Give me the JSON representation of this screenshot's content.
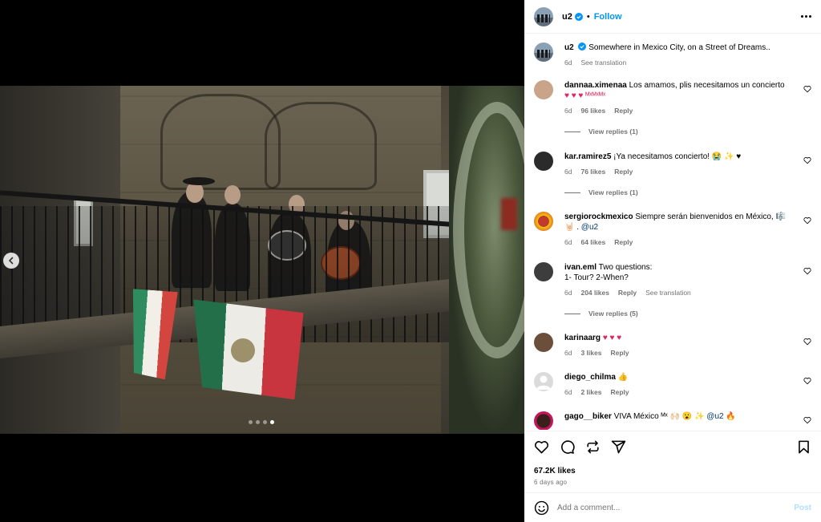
{
  "post": {
    "username": "u2",
    "follow_label": "Follow",
    "separator": "•",
    "caption": "Somewhere in Mexico City, on a Street of Dreams..",
    "caption_age": "6d",
    "see_translation": "See translation"
  },
  "carousel": {
    "slide_count": 4,
    "active_index": 3
  },
  "comments": [
    {
      "user": "dannaa.ximenaa",
      "text": "Los amamos, plis necesitamos un concierto",
      "text2": "♥ ♥ ♥ ᴹˣᴹˣᴹˣ",
      "age": "6d",
      "likes": "96 likes",
      "reply": "Reply",
      "view_replies": "View replies (1)"
    },
    {
      "user": "kar.ramirez5",
      "text": "¡Ya necesitamos concierto! 😭 ✨ ♥",
      "age": "6d",
      "likes": "76 likes",
      "reply": "Reply",
      "view_replies": "View replies (1)"
    },
    {
      "user": "sergiorockmexico",
      "text": "Siempre serán bienvenidos en México, 🎼",
      "text2": "🤘🏻 .",
      "mention": "@u2",
      "age": "6d",
      "likes": "64 likes",
      "reply": "Reply"
    },
    {
      "user": "ivan.eml",
      "text": "Two questions:",
      "text2": "1- Tour? 2-When?",
      "age": "6d",
      "likes": "204 likes",
      "reply": "Reply",
      "see_translation": "See translation",
      "view_replies": "View replies (5)"
    },
    {
      "user": "karinaarg",
      "text": "♥ ♥ ♥",
      "age": "6d",
      "likes": "3 likes",
      "reply": "Reply"
    },
    {
      "user": "diego_chilma",
      "text": "👍",
      "age": "6d",
      "likes": "2 likes",
      "reply": "Reply"
    },
    {
      "user": "gago__biker",
      "text": "VIVA México ᴹˣ 🙌🏻 😮 ✨",
      "mention": "@u2",
      "text3": "🔥"
    }
  ],
  "actions": {
    "likes": "67.2K likes",
    "ago": "6 days ago"
  },
  "add_comment": {
    "placeholder": "Add a comment...",
    "post_label": "Post"
  },
  "colors": {
    "link_blue": "#0095f6",
    "verified_blue": "#0095f6",
    "muted": "#737373",
    "post_disabled": "#b2dffc"
  }
}
